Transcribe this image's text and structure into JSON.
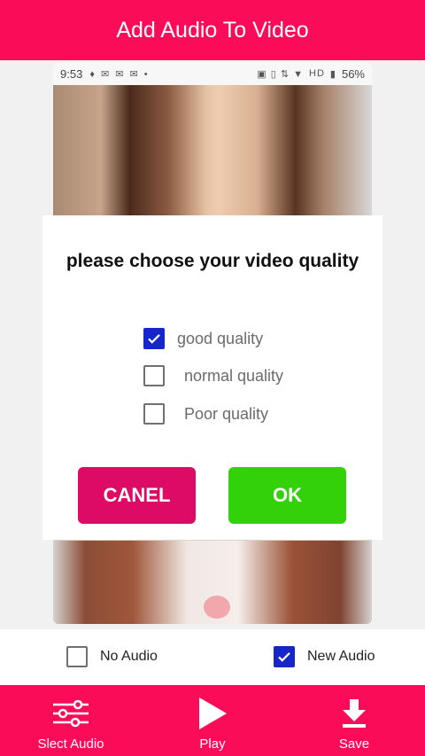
{
  "app_bar": {
    "title": "Add Audio To Video"
  },
  "status_bar": {
    "time": "9:53",
    "network": "HD",
    "battery": "56%"
  },
  "dialog": {
    "title": "please choose your video quality",
    "options": [
      {
        "label": "good quality",
        "checked": true
      },
      {
        "label": "normal quality",
        "checked": false
      },
      {
        "label": "Poor quality",
        "checked": false
      }
    ],
    "cancel_label": "CANEL",
    "ok_label": "OK"
  },
  "audio_options": [
    {
      "label": "No Audio",
      "checked": false
    },
    {
      "label": "New Audio",
      "checked": true
    }
  ],
  "bottom_nav": [
    {
      "label": "Slect Audio",
      "icon": "sliders-icon"
    },
    {
      "label": "Play",
      "icon": "play-icon"
    },
    {
      "label": "Save",
      "icon": "download-icon"
    }
  ],
  "colors": {
    "primary": "#fb0c58",
    "cancel_button": "#de0b66",
    "ok_button": "#33d10a",
    "checkbox_checked": "#1726c8"
  }
}
